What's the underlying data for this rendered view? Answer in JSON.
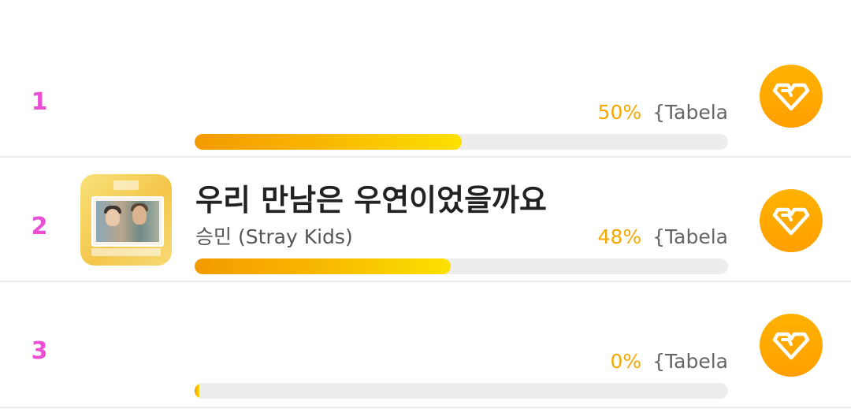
{
  "rows": [
    {
      "rank": "1",
      "title": "",
      "artist": "",
      "percent_label": "50%",
      "percent": 50,
      "tabela": "{Tabela",
      "has_thumb": false
    },
    {
      "rank": "2",
      "title": "우리 만남은 우연이었을까요",
      "artist": "승민 (Stray Kids)",
      "percent_label": "48%",
      "percent": 48,
      "tabela": "{Tabela",
      "has_thumb": true
    },
    {
      "rank": "3",
      "title": "",
      "artist": "",
      "percent_label": "0%",
      "percent": 0,
      "tabela": "{Tabela",
      "has_thumb": false
    }
  ],
  "vote_icon": "heart-diamond-icon",
  "colors": {
    "rank": "#e84fd2",
    "accent": "#ffa800",
    "percent": "#f5a800",
    "track": "#ededed"
  }
}
